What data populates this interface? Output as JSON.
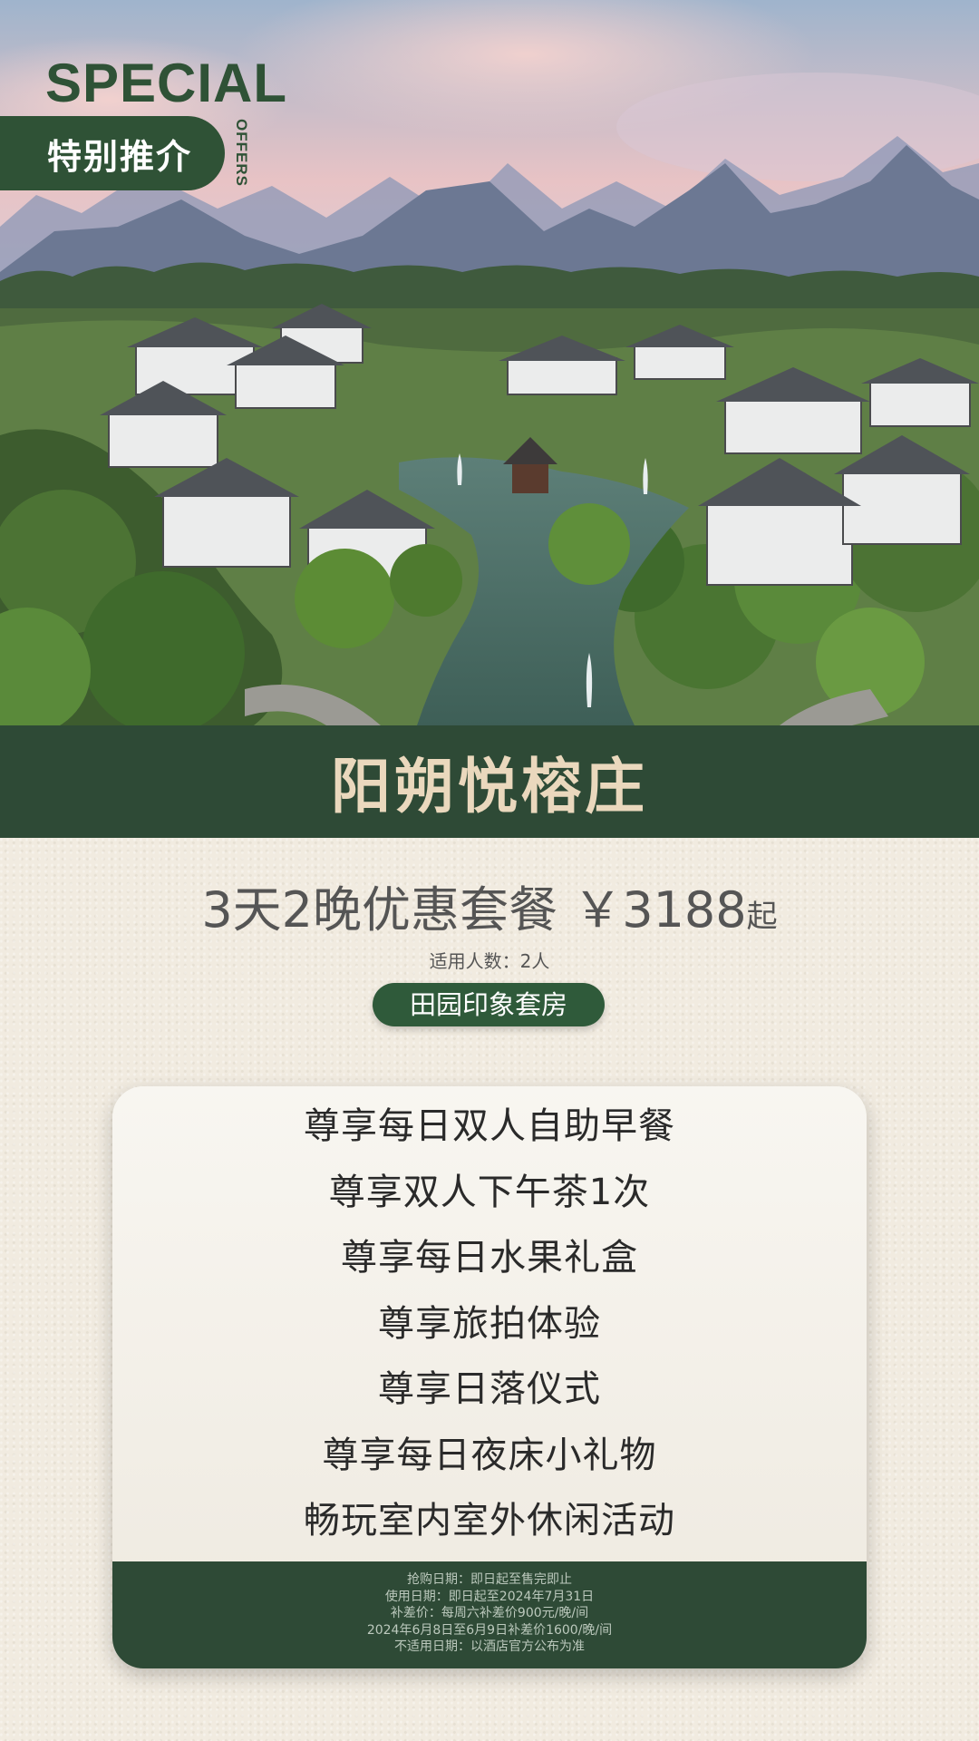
{
  "header": {
    "special": "SPECIAL",
    "tag": "特别推介",
    "offers": "OFFERS"
  },
  "hero": {
    "scene": "aerial resort among karst mountains with pond and fountain"
  },
  "title": "阳朔悦榕庄",
  "offer": {
    "package": "3天2晚优惠套餐",
    "price": "￥3188",
    "price_suffix": "起",
    "persons": "适用人数：2人",
    "room_type": "田园印象套房"
  },
  "benefits": [
    "尊享每日双人自助早餐",
    "尊享双人下午茶1次",
    "尊享每日水果礼盒",
    "尊享旅拍体验",
    "尊享日落仪式",
    "尊享每日夜床小礼物",
    "畅玩室内室外休闲活动"
  ],
  "terms": [
    "抢购日期：即日起至售完即止",
    "使用日期：即日起至2024年7月31日",
    "补差价：每周六补差价900元/晚/间",
    "2024年6月8日至6月9日补差价1600/晚/间",
    "不适用日期：以酒店官方公布为准"
  ],
  "colors": {
    "brand_green": "#2f5236",
    "band_green": "#2e4a36",
    "title_gold": "#ead8bd",
    "paper": "#f1ebe0"
  }
}
